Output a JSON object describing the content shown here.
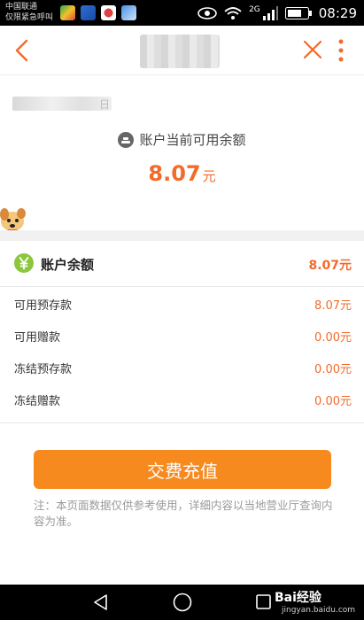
{
  "status_bar": {
    "carrier_line1": "中国联通",
    "carrier_line2": "仅限紧急呼叫",
    "network": "2G",
    "time": "08:29"
  },
  "header": {
    "back_icon": "chevron-left-icon",
    "close_icon": "close-icon",
    "more_icon": "more-vertical-icon"
  },
  "summary": {
    "date_tail": "日",
    "available_label": "账户当前可用余额",
    "amount": "8.07",
    "unit": "元"
  },
  "balance": {
    "title": "账户余额",
    "total": "8.07元",
    "rows": [
      {
        "label": "可用预存款",
        "value": "8.07元"
      },
      {
        "label": "可用赠款",
        "value": "0.00元"
      },
      {
        "label": "冻结预存款",
        "value": "0.00元"
      },
      {
        "label": "冻结赠款",
        "value": "0.00元"
      }
    ]
  },
  "action": {
    "recharge_label": "交费充值"
  },
  "note": "注：本页面数据仅供参考使用，详细内容以当地营业厅查询内容为准。",
  "watermark": {
    "brand": "Bai经验",
    "url": "jingyan.baidu.com"
  },
  "colors": {
    "accent": "#f36a2a",
    "button": "#f68a1f",
    "yen_icon": "#8cc63f"
  }
}
